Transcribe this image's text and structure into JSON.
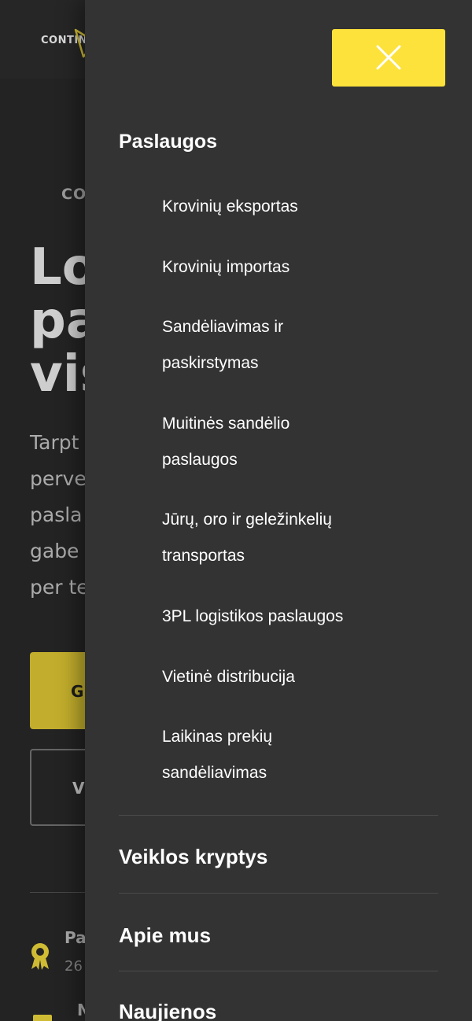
{
  "background": {
    "logo_text": "CONTIN",
    "kicker": "CO",
    "headline": "Lo\npa\nvis",
    "body": "Tarpt\nperve\npasla\ngabe\nper te",
    "primary_button": "G",
    "secondary_button": "V",
    "award_title": "Pa",
    "award_sub": "26",
    "next_title": "N"
  },
  "drawer": {
    "close_icon": "close-icon",
    "section_title": "Paslaugos",
    "services": [
      "Krovinių eksportas",
      "Krovinių importas",
      "Sandėliavimas ir paskirstymas",
      "Muitinės sandėlio paslaugos",
      "Jūrų, oro ir geležinkelių transportas",
      "3PL logistikos paslaugos",
      "Vietinė distribucija",
      "Laikinas prekių sandėliavimas"
    ],
    "nav": {
      "veiklos": "Veiklos kryptys",
      "apie": "Apie mus",
      "naujienos": "Naujienos"
    }
  },
  "colors": {
    "accent": "#fde23b",
    "drawer_bg": "#333333",
    "page_bg": "#2a2a2a"
  }
}
